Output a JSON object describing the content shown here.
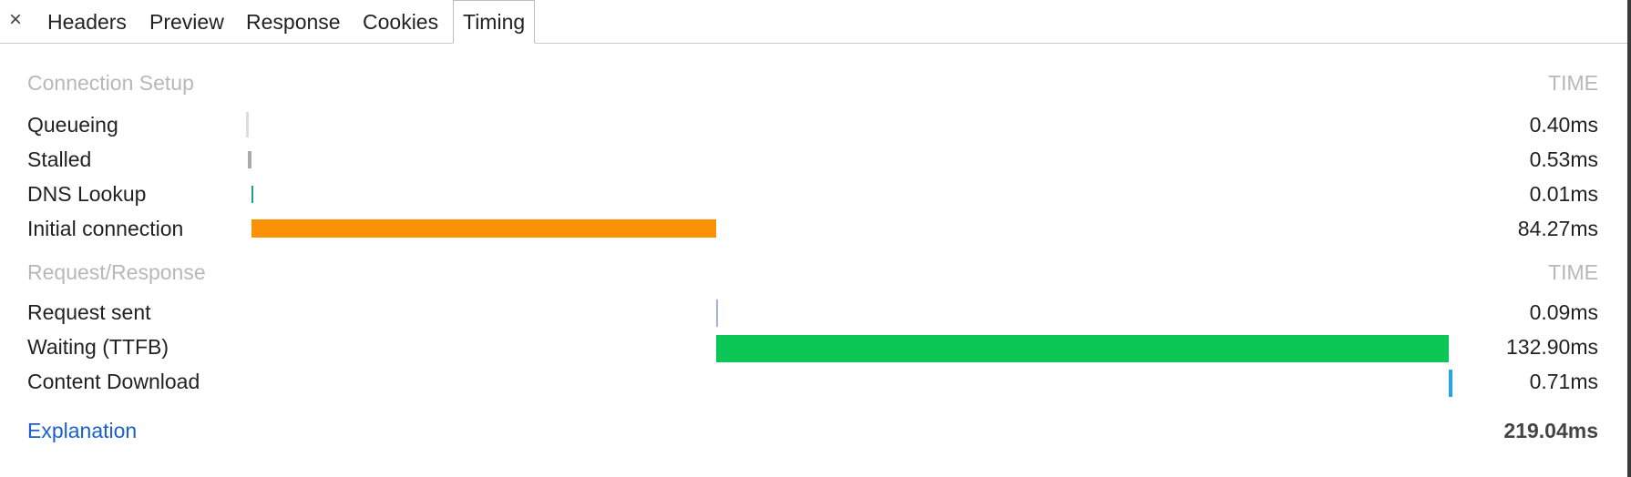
{
  "tabs": {
    "close": "×",
    "items": [
      {
        "label": "Headers"
      },
      {
        "label": "Preview"
      },
      {
        "label": "Response"
      },
      {
        "label": "Cookies"
      },
      {
        "label": "Timing",
        "active": true
      }
    ]
  },
  "connection_setup": {
    "title": "Connection Setup",
    "time_header": "TIME",
    "rows": [
      {
        "label": "Queueing",
        "time": "0.40ms",
        "color": "#dddddd"
      },
      {
        "label": "Stalled",
        "time": "0.53ms",
        "color": "#aaaaaa"
      },
      {
        "label": "DNS Lookup",
        "time": "0.01ms",
        "color": "#1f9e8f"
      },
      {
        "label": "Initial connection",
        "time": "84.27ms",
        "color": "#fb9206"
      }
    ]
  },
  "request_response": {
    "title": "Request/Response",
    "time_header": "TIME",
    "rows": [
      {
        "label": "Request sent",
        "time": "0.09ms",
        "color": "#9fb8cf"
      },
      {
        "label": "Waiting (TTFB)",
        "time": "132.90ms",
        "color": "#0cc656"
      },
      {
        "label": "Content Download",
        "time": "0.71ms",
        "color": "#2aa5e0"
      }
    ]
  },
  "footer": {
    "explanation": "Explanation",
    "total": "219.04ms"
  },
  "colors": {
    "link": "#1a5fd1",
    "section_header": "#b8b8b8"
  }
}
